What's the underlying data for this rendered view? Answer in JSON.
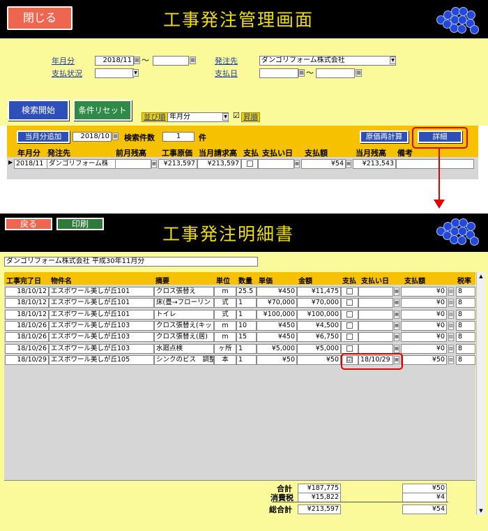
{
  "top": {
    "close_label": "閉じる",
    "title": "工事発注管理画面",
    "filters": {
      "yearmonth_label": "年月分",
      "yearmonth_from": "2018/11",
      "yearmonth_tilde": "～",
      "yearmonth_to": "",
      "payment_status_label": "支払状況",
      "payment_status_value": "",
      "orderee_label": "発注先",
      "orderee_value": "ダンゴリフォーム株式会社",
      "payment_date_label": "支払日",
      "payment_date_from": "",
      "payment_date_tilde": "～",
      "payment_date_to": ""
    },
    "search_label": "検索開始",
    "reset_label": "条件リセット",
    "sort_label": "並び順",
    "sort_value": "年月分",
    "asc_checked": "☑",
    "asc_label": "昇順",
    "add_month_label": "当月分追加",
    "add_month_value": "2018/10",
    "search_count_label": "検索件数",
    "search_count_value": "1",
    "search_count_unit": "件",
    "recalc_label": "原価再計算",
    "detail_label": "詳細",
    "columns": [
      "年月分",
      "発注先",
      "前月残高",
      "工事原価",
      "当月請求高",
      "支払",
      "支払い日",
      "支払額",
      "当月残高",
      "備考"
    ],
    "row": {
      "yearmonth": "2018/11",
      "orderee": "ダンゴリフォーム株",
      "prev_balance": "",
      "cost": "¥213,597",
      "billing": "¥213,597",
      "paid": "",
      "pay_date": "",
      "pay_amount": "¥54",
      "balance": "¥213,543",
      "note": ""
    }
  },
  "bottom": {
    "back_label": "戻る",
    "print_label": "印刷",
    "title": "工事発注明細書",
    "subject": "ダンゴリフォーム株式会社 平成30年11月分",
    "columns": [
      "工事完了日",
      "物件名",
      "摘要",
      "単位",
      "数量",
      "単価",
      "金額",
      "支払",
      "支払い日",
      "支払額",
      "税率"
    ],
    "rows": [
      {
        "date": "18/10/12",
        "property": "エスポワール美しが丘101",
        "desc": "クロス張替え",
        "unit": "m",
        "qty": "25.5",
        "price": "¥450",
        "amount": "¥11,475",
        "paid": "",
        "pay_date": "",
        "pay_amount": "¥0",
        "tax": "8"
      },
      {
        "date": "18/10/12",
        "property": "エスポワール美しが丘101",
        "desc": "床(畳→フローリン",
        "unit": "式",
        "qty": "1",
        "price": "¥70,000",
        "amount": "¥70,000",
        "paid": "",
        "pay_date": "",
        "pay_amount": "¥0",
        "tax": "8"
      },
      {
        "date": "18/10/12",
        "property": "エスポワール美しが丘101",
        "desc": "トイレ",
        "unit": "式",
        "qty": "1",
        "price": "¥100,000",
        "amount": "¥100,000",
        "paid": "",
        "pay_date": "",
        "pay_amount": "¥0",
        "tax": "8"
      },
      {
        "date": "18/10/26",
        "property": "エスポワール美しが丘103",
        "desc": "クロス張替え(キッ",
        "unit": "m",
        "qty": "10",
        "price": "¥450",
        "amount": "¥4,500",
        "paid": "",
        "pay_date": "",
        "pay_amount": "¥0",
        "tax": "8"
      },
      {
        "date": "18/10/26",
        "property": "エスポワール美しが丘103",
        "desc": "クロス張替え(居)",
        "unit": "m",
        "qty": "15",
        "price": "¥450",
        "amount": "¥6,750",
        "paid": "",
        "pay_date": "",
        "pay_amount": "¥0",
        "tax": "8"
      },
      {
        "date": "18/10/26",
        "property": "エスポワール美しが丘103",
        "desc": "水廻点検",
        "unit": "ヶ所",
        "qty": "1",
        "price": "¥5,000",
        "amount": "¥5,000",
        "paid": "",
        "pay_date": "",
        "pay_amount": "¥0",
        "tax": "8"
      },
      {
        "date": "18/10/29",
        "property": "エスポワール美しが丘105",
        "desc": "シンクのビス　調整",
        "unit": "本",
        "qty": "1",
        "price": "¥50",
        "amount": "¥50",
        "paid": "☑",
        "pay_date": "18/10/29",
        "pay_amount": "¥50",
        "tax": "8"
      }
    ],
    "totals": {
      "subtotal_label": "合計",
      "subtotal_amount": "¥187,775",
      "subtotal_pay": "¥50",
      "tax_label": "消費税",
      "tax_amount": "¥15,822",
      "tax_pay": "¥4",
      "grand_label": "総合計",
      "grand_amount": "¥213,597",
      "grand_pay": "¥54"
    }
  }
}
